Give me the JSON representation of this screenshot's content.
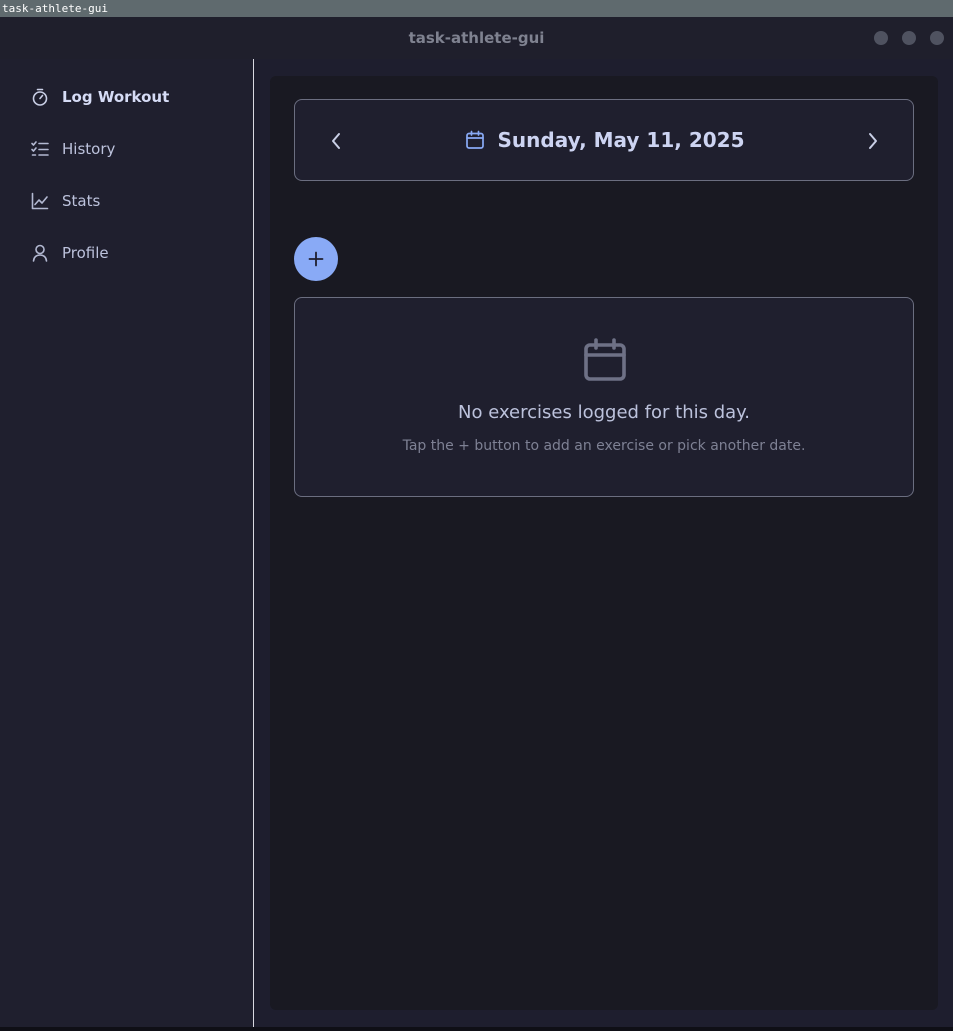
{
  "os_bar": {
    "title": "task-athlete-gui"
  },
  "window": {
    "title": "task-athlete-gui"
  },
  "sidebar": {
    "items": [
      {
        "label": "Log Workout",
        "icon": "stopwatch-icon",
        "active": true
      },
      {
        "label": "History",
        "icon": "checklist-icon",
        "active": false
      },
      {
        "label": "Stats",
        "icon": "line-chart-icon",
        "active": false
      },
      {
        "label": "Profile",
        "icon": "user-icon",
        "active": false
      }
    ]
  },
  "date_nav": {
    "date": "Sunday, May 11, 2025",
    "prev_icon": "chevron-left-icon",
    "next_icon": "chevron-right-icon",
    "calendar_icon": "calendar-icon"
  },
  "add_button": {
    "label": "+"
  },
  "empty_state": {
    "icon": "calendar-icon",
    "message": "No exercises logged for this day.",
    "hint": "Tap the + button to add an exercise or pick another date."
  },
  "colors": {
    "accent": "#89aaf6",
    "background": "#1e1e2e",
    "content_bg": "#191922",
    "text": "#cdd4f2",
    "muted_text": "#7e8194"
  }
}
